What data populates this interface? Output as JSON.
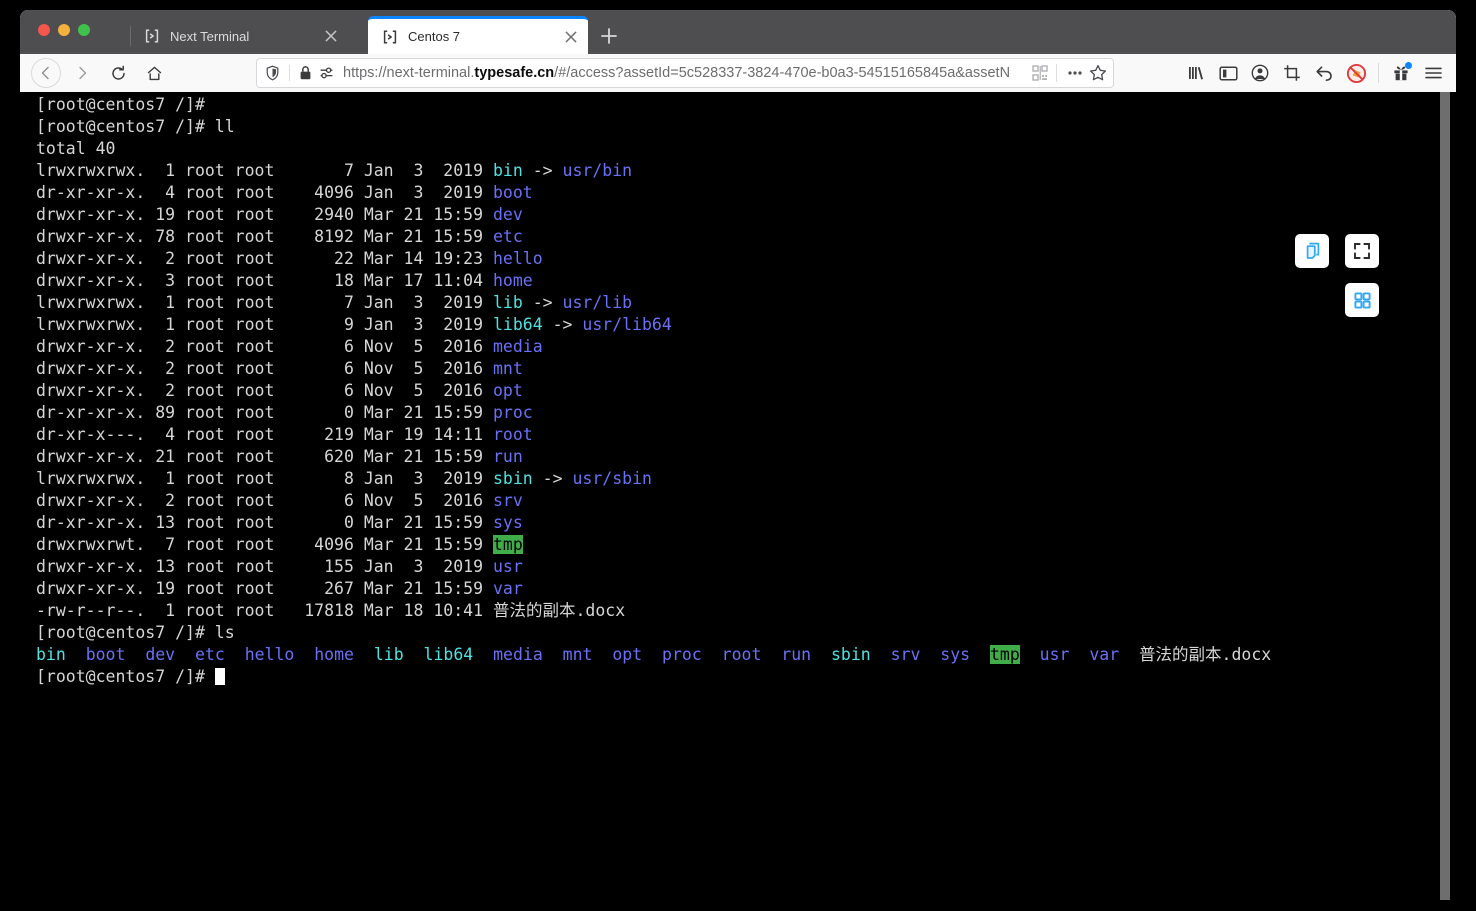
{
  "browser": {
    "tabs": [
      {
        "title": "Next Terminal",
        "favicon": "brackets-icon",
        "active": false
      },
      {
        "title": "Centos 7",
        "favicon": "brackets-icon",
        "active": true
      }
    ],
    "new_tab_label": "+",
    "url": {
      "scheme": "https://",
      "subdomain": "next-terminal.",
      "domain": "typesafe.cn",
      "path": "/#/access?assetId=5c528337-3824-470e-b0a3-54515165845a&assetN",
      "full": "https://next-terminal.typesafe.cn/#/access?assetId=5c528337-3824-470e-b0a3-54515165845a&assetN"
    },
    "nav_icons": [
      "back-arrow-icon",
      "forward-arrow-icon",
      "reload-icon",
      "home-icon"
    ],
    "url_left_icons": [
      "shield-icon",
      "lock-icon",
      "permissions-icon"
    ],
    "url_right_icons": [
      "qr-code-icon",
      "more-actions-icon",
      "bookmark-star-icon"
    ],
    "toolbar_icons": [
      "library-icon",
      "sidebar-icon",
      "account-icon",
      "screenshot-crop-icon",
      "undo-icon",
      "adblock-blocked-icon",
      "gift-icon",
      "menu-hamburger-icon"
    ],
    "accent_color": "#0a84ff",
    "titlebar_color": "#4e4e50"
  },
  "terminal": {
    "theme": {
      "background": "#000000",
      "foreground": "#d6d6d6",
      "symlink_color": "#4ee2e2",
      "directory_color": "#6a71f6",
      "highlight_background": "#3fae49",
      "highlight_foreground": "#000000"
    },
    "prompt": "[root@centos7 /]#",
    "lines": [
      {
        "type": "prompt",
        "text": "[root@centos7 /]#"
      },
      {
        "type": "prompt",
        "text": "[root@centos7 /]# ll"
      },
      {
        "type": "plain",
        "text": "total 40"
      },
      {
        "type": "listing",
        "meta": "lrwxrwxrwx.  1 root root       7 Jan  3  2019 ",
        "name": "bin",
        "name_color": "symlink",
        "arrow": " -> ",
        "target": "usr/bin"
      },
      {
        "type": "listing",
        "meta": "dr-xr-xr-x.  4 root root    4096 Jan  3  2019 ",
        "name": "boot",
        "name_color": "directory"
      },
      {
        "type": "listing",
        "meta": "drwxr-xr-x. 19 root root    2940 Mar 21 15:59 ",
        "name": "dev",
        "name_color": "directory"
      },
      {
        "type": "listing",
        "meta": "drwxr-xr-x. 78 root root    8192 Mar 21 15:59 ",
        "name": "etc",
        "name_color": "directory"
      },
      {
        "type": "listing",
        "meta": "drwxr-xr-x.  2 root root      22 Mar 14 19:23 ",
        "name": "hello",
        "name_color": "directory"
      },
      {
        "type": "listing",
        "meta": "drwxr-xr-x.  3 root root      18 Mar 17 11:04 ",
        "name": "home",
        "name_color": "directory"
      },
      {
        "type": "listing",
        "meta": "lrwxrwxrwx.  1 root root       7 Jan  3  2019 ",
        "name": "lib",
        "name_color": "symlink",
        "arrow": " -> ",
        "target": "usr/lib"
      },
      {
        "type": "listing",
        "meta": "lrwxrwxrwx.  1 root root       9 Jan  3  2019 ",
        "name": "lib64",
        "name_color": "symlink",
        "arrow": " -> ",
        "target": "usr/lib64"
      },
      {
        "type": "listing",
        "meta": "drwxr-xr-x.  2 root root       6 Nov  5  2016 ",
        "name": "media",
        "name_color": "directory"
      },
      {
        "type": "listing",
        "meta": "drwxr-xr-x.  2 root root       6 Nov  5  2016 ",
        "name": "mnt",
        "name_color": "directory"
      },
      {
        "type": "listing",
        "meta": "drwxr-xr-x.  2 root root       6 Nov  5  2016 ",
        "name": "opt",
        "name_color": "directory"
      },
      {
        "type": "listing",
        "meta": "dr-xr-xr-x. 89 root root       0 Mar 21 15:59 ",
        "name": "proc",
        "name_color": "directory"
      },
      {
        "type": "listing",
        "meta": "dr-xr-x---.  4 root root     219 Mar 19 14:11 ",
        "name": "root",
        "name_color": "directory"
      },
      {
        "type": "listing",
        "meta": "drwxr-xr-x. 21 root root     620 Mar 21 15:59 ",
        "name": "run",
        "name_color": "directory"
      },
      {
        "type": "listing",
        "meta": "lrwxrwxrwx.  1 root root       8 Jan  3  2019 ",
        "name": "sbin",
        "name_color": "symlink",
        "arrow": " -> ",
        "target": "usr/sbin"
      },
      {
        "type": "listing",
        "meta": "drwxr-xr-x.  2 root root       6 Nov  5  2016 ",
        "name": "srv",
        "name_color": "directory"
      },
      {
        "type": "listing",
        "meta": "dr-xr-xr-x. 13 root root       0 Mar 21 15:59 ",
        "name": "sys",
        "name_color": "directory"
      },
      {
        "type": "listing",
        "meta": "drwxrwxrwt.  7 root root    4096 Mar 21 15:59 ",
        "name": "tmp",
        "name_color": "highlight"
      },
      {
        "type": "listing",
        "meta": "drwxr-xr-x. 13 root root     155 Jan  3  2019 ",
        "name": "usr",
        "name_color": "directory"
      },
      {
        "type": "listing",
        "meta": "drwxr-xr-x. 19 root root     267 Mar 21 15:59 ",
        "name": "var",
        "name_color": "directory"
      },
      {
        "type": "listing",
        "meta": "-rw-r--r--.  1 root root   17818 Mar 18 10:41 ",
        "name": "普法的副本.docx",
        "name_color": "plain"
      },
      {
        "type": "prompt",
        "text": "[root@centos7 /]# ls"
      },
      {
        "type": "ls-row",
        "items": [
          {
            "text": "bin",
            "color": "symlink"
          },
          {
            "text": "boot",
            "color": "directory"
          },
          {
            "text": "dev",
            "color": "directory"
          },
          {
            "text": "etc",
            "color": "directory"
          },
          {
            "text": "hello",
            "color": "directory"
          },
          {
            "text": "home",
            "color": "directory"
          },
          {
            "text": "lib",
            "color": "symlink"
          },
          {
            "text": "lib64",
            "color": "symlink"
          },
          {
            "text": "media",
            "color": "directory"
          },
          {
            "text": "mnt",
            "color": "directory"
          },
          {
            "text": "opt",
            "color": "directory"
          },
          {
            "text": "proc",
            "color": "directory"
          },
          {
            "text": "root",
            "color": "directory"
          },
          {
            "text": "run",
            "color": "directory"
          },
          {
            "text": "sbin",
            "color": "symlink"
          },
          {
            "text": "srv",
            "color": "directory"
          },
          {
            "text": "sys",
            "color": "directory"
          },
          {
            "text": "tmp",
            "color": "highlight"
          },
          {
            "text": "usr",
            "color": "directory"
          },
          {
            "text": "var",
            "color": "directory"
          },
          {
            "text": "普法的副本.docx",
            "color": "plain"
          }
        ]
      },
      {
        "type": "cursor-prompt",
        "text": "[root@centos7 /]# "
      }
    ],
    "floating_buttons": [
      {
        "name": "copy-paste-button",
        "icon": "copy-icon"
      },
      {
        "name": "fullscreen-button",
        "icon": "expand-icon"
      },
      {
        "name": "apps-grid-button",
        "icon": "grid-icon"
      }
    ]
  }
}
